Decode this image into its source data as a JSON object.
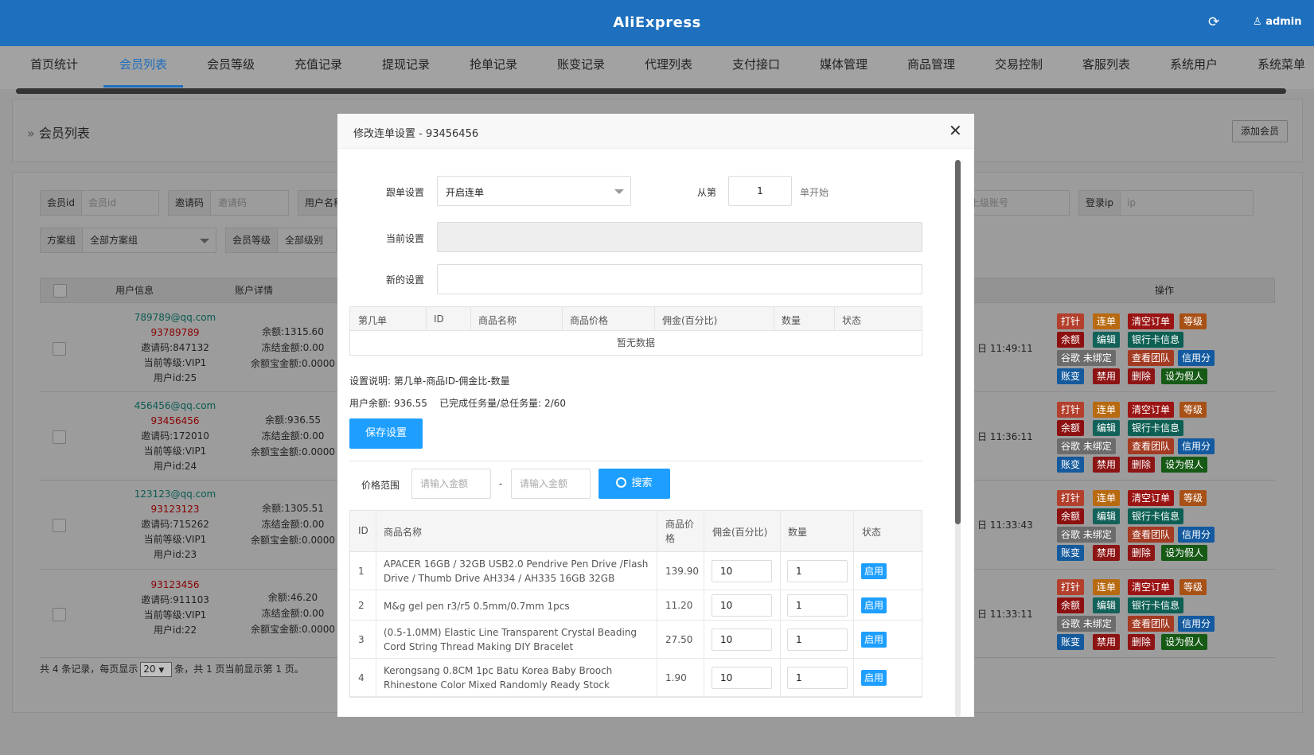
{
  "header": {
    "brand": "AliExpress",
    "admin": "admin"
  },
  "nav": [
    {
      "label": "首页统计",
      "active": false
    },
    {
      "label": "会员列表",
      "active": true
    },
    {
      "label": "会员等级",
      "active": false
    },
    {
      "label": "充值记录",
      "active": false
    },
    {
      "label": "提现记录",
      "active": false
    },
    {
      "label": "抢单记录",
      "active": false
    },
    {
      "label": "账变记录",
      "active": false
    },
    {
      "label": "代理列表",
      "active": false
    },
    {
      "label": "支付接口",
      "active": false
    },
    {
      "label": "媒体管理",
      "active": false
    },
    {
      "label": "商品管理",
      "active": false
    },
    {
      "label": "交易控制",
      "active": false
    },
    {
      "label": "客服列表",
      "active": false
    },
    {
      "label": "系统用户",
      "active": false
    },
    {
      "label": "系统菜单",
      "active": false
    }
  ],
  "page": {
    "title": "会员列表",
    "add_button": "添加会员"
  },
  "filters": {
    "member_id": {
      "label": "会员id",
      "placeholder": "会员id"
    },
    "invite_code": {
      "label": "邀请码",
      "placeholder": "邀请码"
    },
    "username": {
      "label": "用户名称"
    },
    "parent_account": {
      "placeholder": "上级账号"
    },
    "login_ip": {
      "label": "登录ip",
      "placeholder": "ip"
    },
    "plan_group": {
      "label": "方案组",
      "value": "全部方案组"
    },
    "member_level": {
      "label": "会员等级",
      "value": "全部级别"
    }
  },
  "table": {
    "col_user": "用户信息",
    "col_account": "账户详情",
    "col_ops": "操作",
    "rows": [
      {
        "email": "789789@qq.com",
        "phone": "93789789",
        "invite": "邀请码:847132",
        "level": "当前等级:VIP1",
        "uid": "用户id:25",
        "balance": "余额:1315.60",
        "frozen": "冻结金额:0.00",
        "yeb": "余额宝金额:0.0000",
        "time": "日 11:49:11"
      },
      {
        "email": "456456@qq.com",
        "phone": "93456456",
        "invite": "邀请码:172010",
        "level": "当前等级:VIP1",
        "uid": "用户id:24",
        "balance": "余额:936.55",
        "frozen": "冻结金额:0.00",
        "yeb": "余额宝金额:0.0000",
        "time": "日 11:36:11"
      },
      {
        "email": "123123@qq.com",
        "phone": "93123123",
        "invite": "邀请码:715262",
        "level": "当前等级:VIP1",
        "uid": "用户id:23",
        "balance": "余额:1305.51",
        "frozen": "冻结金额:0.00",
        "yeb": "余额宝金额:0.0000",
        "time": "日 11:33:43"
      },
      {
        "email": "",
        "phone": "93123456",
        "invite": "邀请码:911103",
        "level": "当前等级:VIP1",
        "uid": "用户id:22",
        "balance": "余额:46.20",
        "frozen": "冻结金额:0.00",
        "yeb": "余额宝金额:0.0000",
        "time": "日 11:33:11"
      }
    ],
    "ops": [
      "打针",
      "连单",
      "清空订单",
      "等级",
      "余额",
      "编辑",
      "银行卡信息",
      "谷歌 未绑定",
      "查看团队",
      "信用分",
      "账变",
      "禁用",
      "删除",
      "设为假人"
    ],
    "op_colors": [
      "#b2402d",
      "#b86a11",
      "#9b1414",
      "#a85117",
      "#8d1010",
      "#13625a",
      "#0d5f54",
      "#6c6c6c",
      "#a33a22",
      "#135aa0",
      "#145a9c",
      "#8d1414",
      "#8d1414",
      "#165a16"
    ]
  },
  "pager": {
    "prefix": "共 4 条记录，每页显示",
    "size": "20",
    "suffix": "条，共 1 页当前显示第 1 页。"
  },
  "modal": {
    "title": "修改连单设置 - 93456456",
    "follow_label": "跟单设置",
    "follow_value": "开启连单",
    "from_label": "从第",
    "from_value": "1",
    "start_label": "单开始",
    "current_label": "当前设置",
    "new_label": "新的设置",
    "config_headers": [
      "第几单",
      "ID",
      "商品名称",
      "商品价格",
      "佣金(百分比)",
      "数量",
      "状态"
    ],
    "empty": "暂无数据",
    "note": "设置说明: 第几单-商品ID-佣金比-数量",
    "stats": "用户余额: 936.55    已完成任务量/总任务量: 2/60",
    "save": "保存设置",
    "price_label": "价格范围",
    "min_placeholder": "请输入金额",
    "dash": "-",
    "max_placeholder": "请输入金额",
    "search": "搜索",
    "product_headers": {
      "id": "ID",
      "name": "商品名称",
      "price": "商品价格",
      "commission": "佣金(百分比)",
      "qty": "数量",
      "status": "状态"
    },
    "products": [
      {
        "id": "1",
        "name": "APACER 16GB / 32GB USB2.0 Pendrive Pen Drive /Flash Drive / Thumb Drive AH334 / AH335 16GB 32GB",
        "price": "139.90",
        "commission": "10",
        "qty": "1",
        "status": "启用"
      },
      {
        "id": "2",
        "name": "M&g gel pen r3/r5 0.5mm/0.7mm 1pcs",
        "price": "11.20",
        "commission": "10",
        "qty": "1",
        "status": "启用"
      },
      {
        "id": "3",
        "name": "(0.5-1.0MM) Elastic Line Transparent Crystal Beading Cord String Thread Making DIY Bracelet",
        "price": "27.50",
        "commission": "10",
        "qty": "1",
        "status": "启用"
      },
      {
        "id": "4",
        "name": "Kerongsang 0.8CM 1pc Batu Korea Baby Brooch Rhinestone Color Mixed Randomly Ready Stock",
        "price": "1.90",
        "commission": "10",
        "qty": "1",
        "status": "启用"
      }
    ]
  }
}
